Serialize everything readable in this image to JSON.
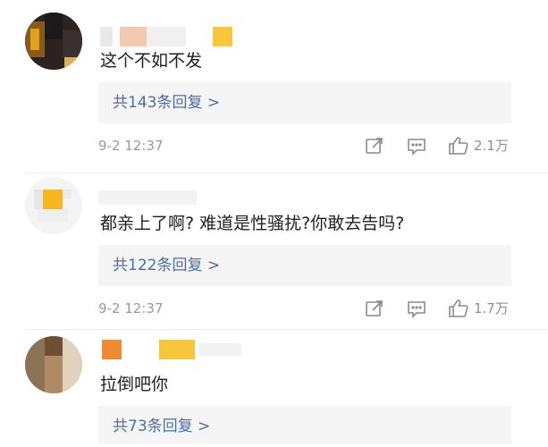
{
  "comments": [
    {
      "text": "这个不如不发",
      "replies_label": "共143条回复 >",
      "time": "9-2 12:37",
      "likes": "2.1万"
    },
    {
      "text": "都亲上了啊? 难道是性骚扰?你敢去告吗?",
      "replies_label": "共122条回复 >",
      "time": "9-2 12:37",
      "likes": "1.7万"
    },
    {
      "text": "拉倒吧你",
      "replies_label": "共73条回复 >"
    }
  ],
  "icons": {
    "share": "share-icon",
    "comment": "comment-icon",
    "like": "like-icon"
  },
  "colors": {
    "reply_link": "#4a6ea8",
    "reply_bg": "#f5f5f6",
    "meta_text": "#9a9a9a",
    "mosaic_orange": "#f5a623",
    "mosaic_yellow": "#f7c63a"
  }
}
